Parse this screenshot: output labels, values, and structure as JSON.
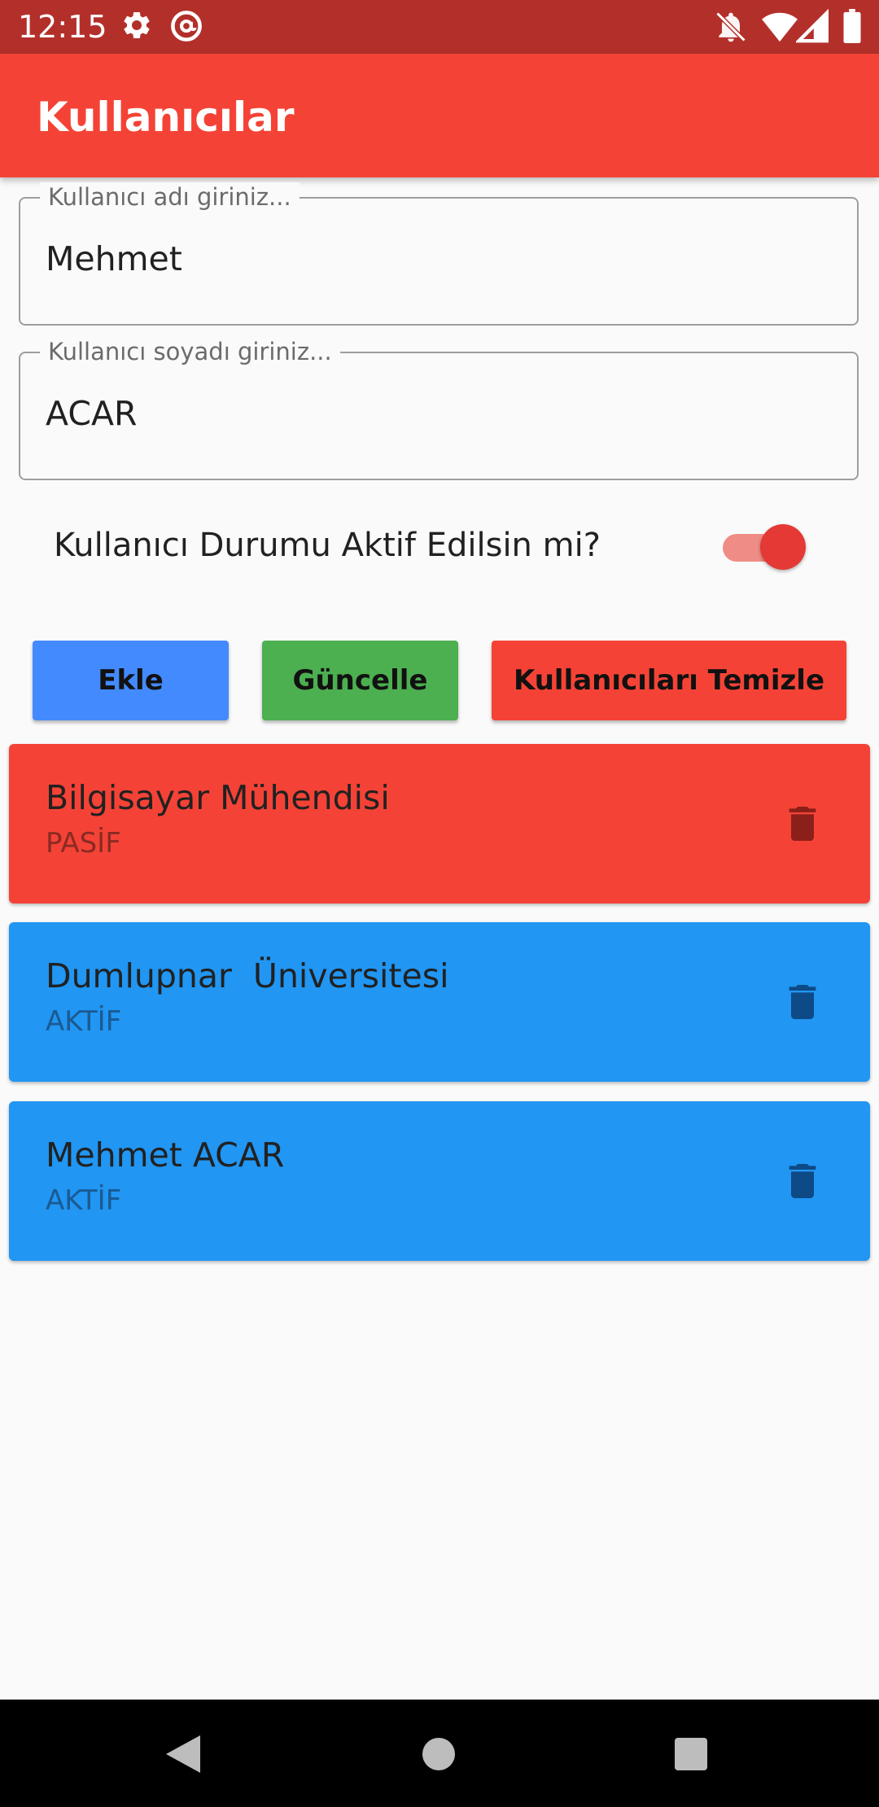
{
  "status_bar": {
    "time": "12:15",
    "left_icons": [
      "gear-icon",
      "at-sign-icon"
    ],
    "right_icons": [
      "notifications-off-icon",
      "wifi-icon",
      "signal-icon",
      "battery-icon"
    ]
  },
  "app_bar": {
    "title": "Kullanıcılar",
    "color": "#f44336"
  },
  "form": {
    "name_field": {
      "label": "Kullanıcı adı giriniz...",
      "value": "Mehmet"
    },
    "surname_field": {
      "label": "Kullanıcı soyadı giriniz...",
      "value": "ACAR"
    },
    "active_switch": {
      "label": "Kullanıcı Durumu Aktif Edilsin mi?",
      "checked": true
    }
  },
  "buttons": {
    "add": {
      "label": "Ekle",
      "color": "#448aff"
    },
    "update": {
      "label": "Güncelle",
      "color": "#4caf50"
    },
    "clear": {
      "label": "Kullanıcıları Temizle",
      "color": "#f44336"
    }
  },
  "users": [
    {
      "name": "Bilgisayar Mühendisi",
      "status": "PASİF",
      "color": "#f44336",
      "icon": "trash-icon"
    },
    {
      "name": "Dumlupnar  Üniversitesi",
      "status": "AKTİF",
      "color": "#2196f3",
      "icon": "trash-icon"
    },
    {
      "name": "Mehmet ACAR",
      "status": "AKTİF",
      "color": "#2196f3",
      "icon": "trash-icon"
    }
  ],
  "nav_bar": {
    "icons": [
      "back-icon",
      "home-icon",
      "recents-icon"
    ]
  }
}
